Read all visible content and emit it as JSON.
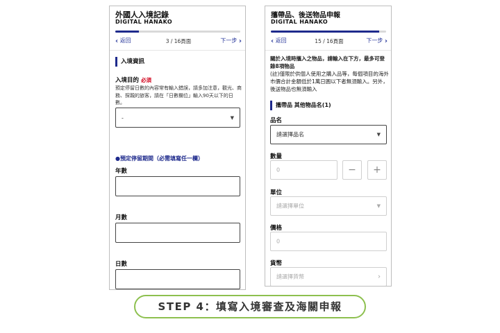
{
  "left": {
    "title": "外國人入境記錄",
    "subtitle": "DIGITAL HANAKO",
    "progress": 0.19,
    "nav": {
      "back": "返回",
      "page": "3 / 16頁面",
      "next": "下一步"
    },
    "section": "入境資訊",
    "purpose_label": "入境目的",
    "required": "必須",
    "purpose_help": "預定停留日數的內容常有輸入錯誤，請多加注意，觀光、商務、探親的旅客，請在「日數欄位」輸入90天以下的日數。",
    "purpose_value": "-",
    "stay_note": "●預定停留期間（必需填寫任一欄）",
    "years_label": "年數",
    "months_label": "月數",
    "days_label": "日數"
  },
  "right": {
    "title": "攜帶品、後送物品申報",
    "subtitle": "DIGITAL HANAKO",
    "progress": 0.94,
    "nav": {
      "back": "返回",
      "page": "15 / 16頁面",
      "next": "下一步"
    },
    "intro_bold": "關於入境時攜入之物品，請輸入在下方，最多可登錄8項物品",
    "intro_note": "(註)僅限於供個人使用之購入品等，每個項目的海外市價合計金額低於1萬日圓以下者無須輸入。另外，後送物品也無須輸入",
    "section": "攜帶品 其他物品名(1)",
    "item_label": "品名",
    "item_placeholder": "請選擇品名",
    "qty_label": "數量",
    "qty_value": "0",
    "unit_label": "單位",
    "unit_placeholder": "請選擇單位",
    "price_label": "價格",
    "price_value": "0",
    "currency_label": "貨幣",
    "currency_placeholder": "請選擇貨幣"
  },
  "banner": "STEP 4：填寫入境審查及海關申報"
}
